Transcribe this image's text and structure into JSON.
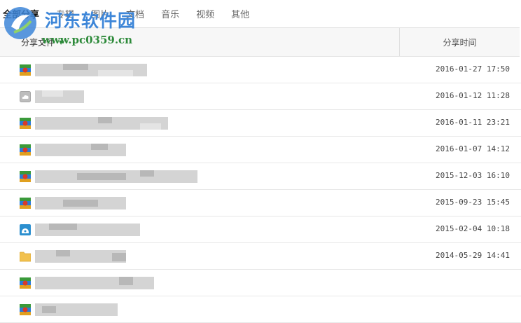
{
  "tabs": [
    "全部分享",
    "专辑",
    "图片",
    "文档",
    "音乐",
    "视频",
    "其他"
  ],
  "watermark": {
    "title": "河东软件园",
    "url": "www.pc0359.cn"
  },
  "header": {
    "name_label": "分享文件",
    "time_label": "分享时间"
  },
  "rows": [
    {
      "icon": "app-file-icon",
      "date": "2016-01-27 17:50"
    },
    {
      "icon": "cloud-file-icon",
      "date": "2016-01-12 11:28"
    },
    {
      "icon": "app-file-icon",
      "date": "2016-01-11 23:21"
    },
    {
      "icon": "app-file-icon",
      "date": "2016-01-07 14:12"
    },
    {
      "icon": "app-file-icon",
      "date": "2015-12-03 16:10"
    },
    {
      "icon": "app-file-icon",
      "date": "2015-09-23 15:45"
    },
    {
      "icon": "installer-file-icon",
      "date": "2015-02-04 10:18"
    },
    {
      "icon": "folder-icon",
      "date": "2014-05-29 14:41"
    },
    {
      "icon": "app-file-icon",
      "date": ""
    },
    {
      "icon": "app-file-icon",
      "date": ""
    }
  ],
  "colors": {
    "accent": "#3d86d8",
    "url_green": "#2d8a3a",
    "header_bg": "#f7f7f7"
  }
}
